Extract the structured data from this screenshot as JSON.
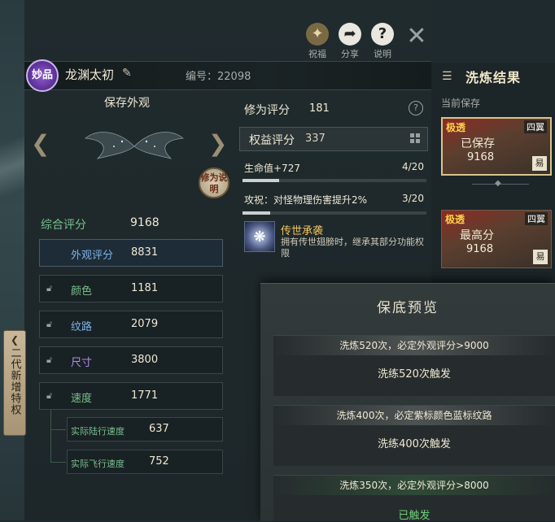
{
  "top_bar": {
    "icons": [
      {
        "label": "祝福",
        "icon": "bless-icon"
      },
      {
        "label": "分享",
        "icon": "share-icon"
      },
      {
        "label": "说明",
        "icon": "help-icon"
      }
    ],
    "close_icon": "close-icon"
  },
  "wing": {
    "quality": "妙品",
    "name": "龙渊太初",
    "serial": "编号：22098",
    "preview_title": "保存外观",
    "explain_btn": "修为说明"
  },
  "scores": {
    "total_label": "综合评分",
    "total_value": "9168",
    "rows": [
      {
        "label": "外观评分",
        "value": "8831",
        "color": "#7fb2e8",
        "locked": false
      },
      {
        "label": "颜色",
        "value": "1181",
        "color": "#79c08b",
        "locked": true
      },
      {
        "label": "纹路",
        "value": "2079",
        "color": "#7fb2e8",
        "locked": true
      },
      {
        "label": "尺寸",
        "value": "3800",
        "color": "#b48ae8",
        "locked": true
      },
      {
        "label": "速度",
        "value": "1771",
        "color": "#79c08b",
        "locked": true
      }
    ],
    "sub_rows": [
      {
        "label": "实际陆行速度",
        "value": "637"
      },
      {
        "label": "实际飞行速度",
        "value": "752"
      }
    ]
  },
  "side_tab": {
    "label": "二代新增特权"
  },
  "cultivation": {
    "label": "修为评分",
    "value": "181",
    "benefit_label": "权益评分",
    "benefit_value": "337",
    "stats": [
      {
        "text": "生命值+727",
        "frac": "4/20",
        "progress": 0.2
      },
      {
        "text": "攻祝：对怪物理伤害提升2%",
        "frac": "3/20",
        "progress": 0.15
      }
    ],
    "legend": {
      "title": "传世承袭",
      "desc": "拥有传世翅膀时，继承其部分功能权限"
    }
  },
  "results": {
    "header": "洗炼结果",
    "current_label": "当前保存",
    "cards": [
      {
        "tag": "极透",
        "type": "四翼",
        "name": "已保存",
        "score": "9168",
        "btn": "易"
      },
      {
        "tag": "极透",
        "type": "四翼",
        "name": "最高分",
        "score": "9168",
        "btn": "易"
      }
    ]
  },
  "guarantee": {
    "title": "保底预览",
    "items": [
      {
        "condition": "洗炼520次，必定外观评分>9000",
        "status": "洗练520次触发",
        "done": false
      },
      {
        "condition": "洗炼400次，必定紫标颜色蓝标纹路",
        "status": "洗练400次触发",
        "done": false
      },
      {
        "condition": "洗炼350次，必定外观评分>8000",
        "status": "已触发",
        "done": true
      }
    ]
  }
}
